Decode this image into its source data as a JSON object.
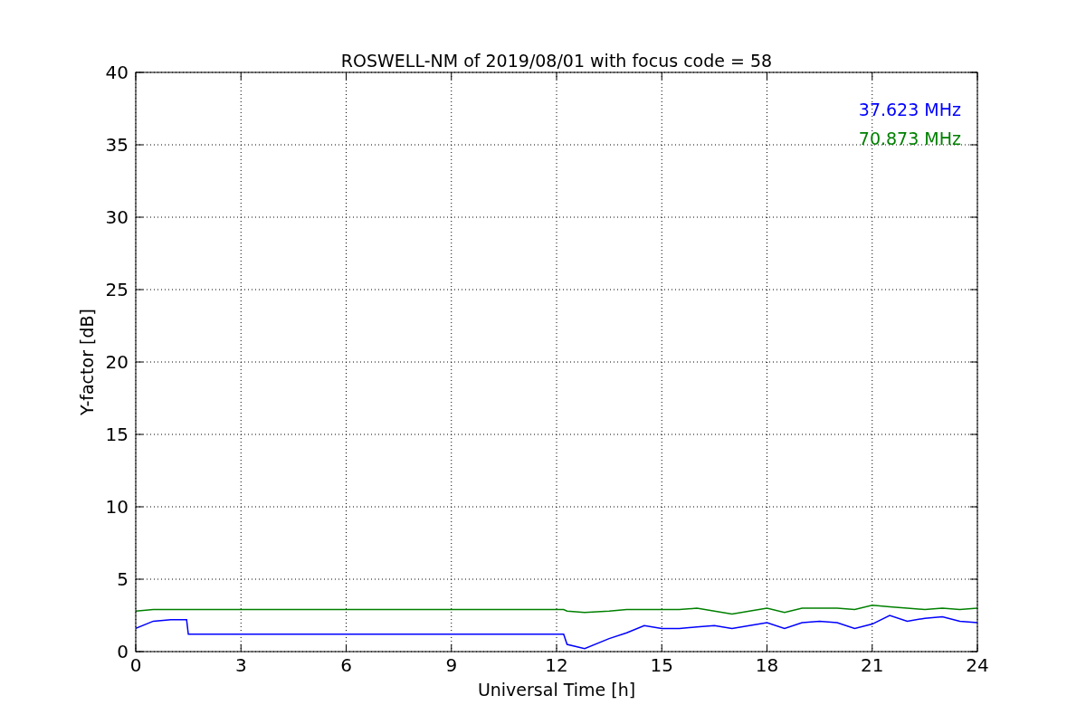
{
  "chart_data": {
    "type": "line",
    "title": "ROSWELL-NM of 2019/08/01 with focus code = 58",
    "xlabel": "Universal Time [h]",
    "ylabel": "Y-factor [dB]",
    "x": [
      0,
      0.5,
      1,
      1.45,
      1.5,
      3,
      6,
      9,
      12.2,
      12.3,
      12.8,
      13.5,
      14,
      14.5,
      15,
      15.5,
      16,
      16.5,
      17,
      17.5,
      18,
      18.5,
      19,
      19.5,
      20,
      20.5,
      21,
      21.5,
      22,
      22.5,
      23,
      23.5,
      24
    ],
    "series": [
      {
        "name": "37.623 MHz",
        "color": "#0000ff",
        "values": [
          1.6,
          2.1,
          2.2,
          2.2,
          1.2,
          1.2,
          1.2,
          1.2,
          1.2,
          0.5,
          0.2,
          0.9,
          1.3,
          1.8,
          1.6,
          1.6,
          1.7,
          1.8,
          1.6,
          1.8,
          2.0,
          1.6,
          2.0,
          2.1,
          2.0,
          1.6,
          1.9,
          2.5,
          2.1,
          2.3,
          2.4,
          2.1,
          2.0
        ]
      },
      {
        "name": "70.873 MHz",
        "color": "#008000",
        "values": [
          2.8,
          2.9,
          2.9,
          2.9,
          2.9,
          2.9,
          2.9,
          2.9,
          2.9,
          2.8,
          2.7,
          2.8,
          2.9,
          2.9,
          2.9,
          2.9,
          3.0,
          2.8,
          2.6,
          2.8,
          3.0,
          2.7,
          3.0,
          3.0,
          3.0,
          2.9,
          3.2,
          3.1,
          3.0,
          2.9,
          3.0,
          2.9,
          3.0
        ]
      }
    ],
    "xlim": [
      0,
      24
    ],
    "ylim": [
      0,
      40
    ],
    "xticks": [
      0,
      3,
      6,
      9,
      12,
      15,
      18,
      21,
      24
    ],
    "yticks": [
      0,
      5,
      10,
      15,
      20,
      25,
      30,
      35,
      40
    ],
    "grid": true
  }
}
